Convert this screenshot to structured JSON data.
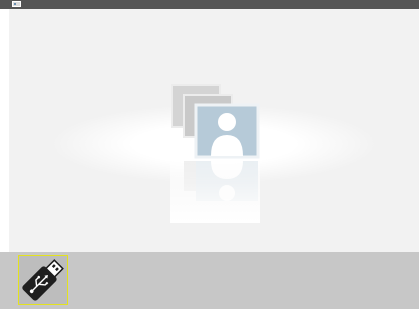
{
  "top_bar": {
    "icon": "input-source-icon"
  },
  "viewer": {
    "empty_state_icon": "photo-stack-icon"
  },
  "device_bar": {
    "devices": [
      {
        "icon": "usb-drive-icon",
        "selected": true
      }
    ],
    "selection_color": "#e3e21f"
  }
}
